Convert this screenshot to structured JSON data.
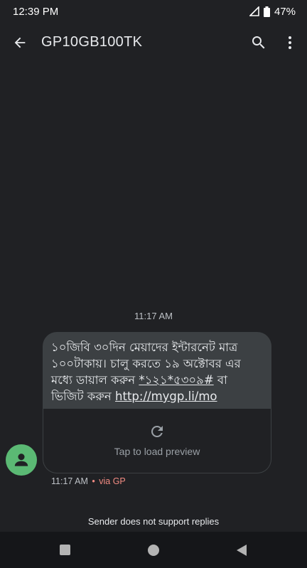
{
  "status_bar": {
    "time": "12:39 PM",
    "battery": "47%"
  },
  "header": {
    "title": "GP10GB100TK"
  },
  "conversation": {
    "timestamp": "11:17 AM",
    "message": {
      "text_part1": "১০জিবি ৩০দিন মেয়াদের ইন্টারনেট মাত্র ১০০টাকায়। চালু করতে ১৯ অক্টোবর এর মধ্যে ডায়াল করুন ",
      "ussd_code": "*১২১*৫৩০৯#",
      "text_part2": " বা ভিজিট করুন ",
      "link": "http://mygp.li/mo",
      "preview_label": "Tap to load preview"
    },
    "meta_time": "11:17 AM",
    "meta_dot": "•",
    "meta_via": "via GP",
    "no_reply_notice": "Sender does not support replies"
  },
  "icons": {
    "back": "arrow-back-icon",
    "search": "search-icon",
    "more": "more-vert-icon",
    "avatar": "person-icon",
    "reload": "refresh-icon"
  },
  "colors": {
    "background": "#202124",
    "bubble": "#3c4043",
    "avatar": "#5bb974",
    "via_accent": "#f28b82"
  }
}
